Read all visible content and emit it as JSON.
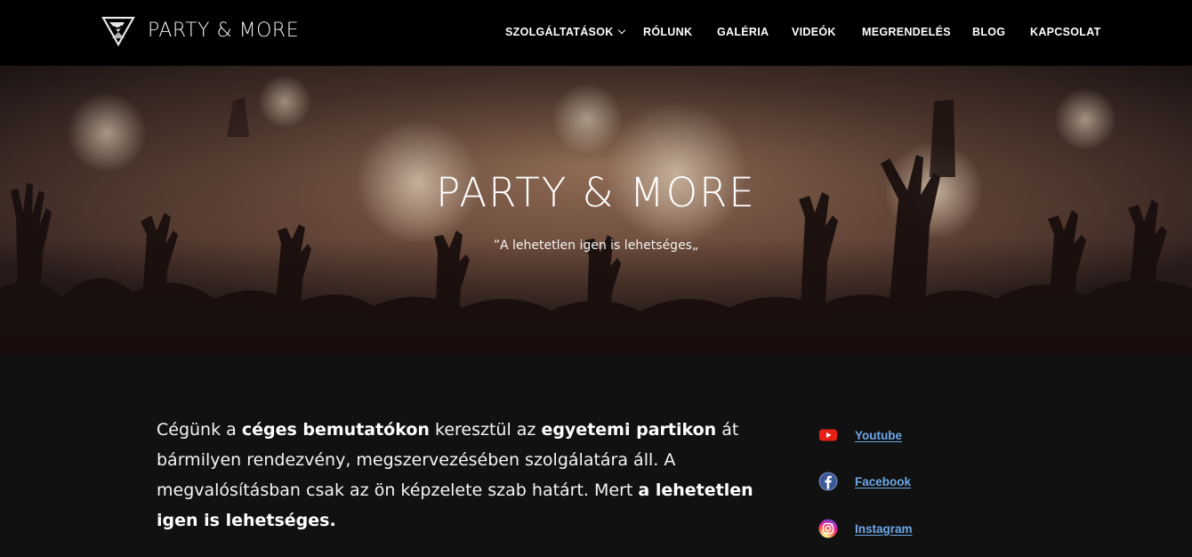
{
  "brand": {
    "name": "PARTY & MORE",
    "logo_icon": "triangle-swirl-logo"
  },
  "nav": {
    "items": [
      {
        "label": "SZOLGÁLTATÁSOK",
        "has_dropdown": true
      },
      {
        "label": "RÓLUNK"
      },
      {
        "label": "GALÉRIA"
      },
      {
        "label": "VIDEÓK"
      },
      {
        "label": "MEGRENDELÉS"
      },
      {
        "label": "BLOG"
      },
      {
        "label": "KAPCSOLAT"
      }
    ]
  },
  "hero": {
    "title": "PARTY & MORE",
    "subtitle": "”A lehetetlen igen is lehetséges„"
  },
  "intro": {
    "segments": [
      {
        "text": "Cégünk a ",
        "bold": false
      },
      {
        "text": "céges bemutatókon",
        "bold": true
      },
      {
        "text": " keresztül az ",
        "bold": false
      },
      {
        "text": "egyetemi partikon",
        "bold": true
      },
      {
        "text": " át bármilyen rendezvény, megszervezésében szolgálatára áll. A megvalósításban csak az ön képzelete szab határt. Mert ",
        "bold": false
      },
      {
        "text": "a lehetetlen igen is lehetséges.",
        "bold": true
      }
    ]
  },
  "social": {
    "links": [
      {
        "label": "Youtube",
        "icon": "youtube-icon",
        "color": "#e62117"
      },
      {
        "label": "Facebook",
        "icon": "facebook-icon",
        "color": "#3b5998"
      },
      {
        "label": "Instagram",
        "icon": "instagram-icon",
        "color": "#d6249f"
      }
    ],
    "link_color": "#6ea8e8"
  },
  "colors": {
    "nav_bg": "#000000",
    "body_bg": "#111111",
    "text": "#ffffff"
  }
}
